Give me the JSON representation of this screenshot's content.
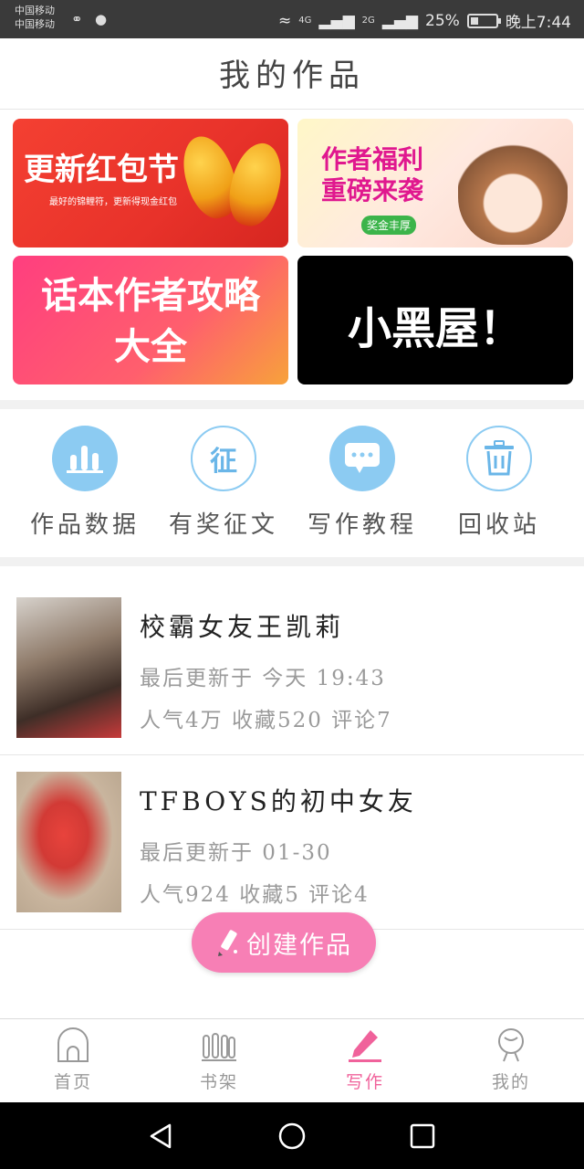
{
  "status_bar": {
    "carrier_1": "中国移动",
    "carrier_2": "中国移动",
    "net_1": "4G",
    "net_2": "2G",
    "battery": "25%",
    "time": "晚上7:44"
  },
  "header": {
    "title": "我的作品"
  },
  "banners": [
    {
      "title": "更新红包节",
      "subtitle": "最好的锦鲤符，更新得现金红包"
    },
    {
      "title_line1": "作者福利",
      "title_line2": "重磅来袭",
      "badge": "奖金丰厚"
    },
    {
      "title_line1": "话本作者攻略",
      "title_line2": "大全"
    },
    {
      "title": "小黑屋！"
    }
  ],
  "menu": [
    {
      "label": "作品数据",
      "icon": "bar-chart-icon"
    },
    {
      "label": "有奖征文",
      "icon": "zheng-badge-icon",
      "glyph": "征"
    },
    {
      "label": "写作教程",
      "icon": "chat-bubble-icon"
    },
    {
      "label": "回收站",
      "icon": "trash-icon"
    }
  ],
  "works": [
    {
      "title": "校霸女友王凯莉",
      "updated": "最后更新于 今天 19:43",
      "stats": "人气4万 收藏520 评论7"
    },
    {
      "title": "TFBOYS的初中女友",
      "updated": "最后更新于 01-30",
      "stats": "人气924 收藏5 评论4"
    }
  ],
  "create_button": {
    "label": "创建作品"
  },
  "tab_bar": [
    {
      "label": "首页",
      "icon": "home-icon"
    },
    {
      "label": "书架",
      "icon": "bookshelf-icon"
    },
    {
      "label": "写作",
      "icon": "pen-icon",
      "active": true
    },
    {
      "label": "我的",
      "icon": "profile-icon"
    }
  ],
  "colors": {
    "accent": "#f0629b",
    "menu_icon": "#8ccbf2"
  }
}
